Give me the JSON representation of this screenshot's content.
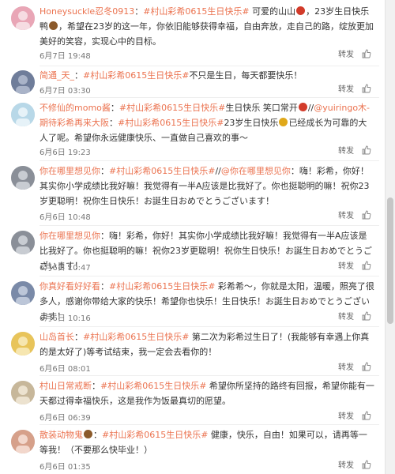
{
  "actions": {
    "repost": "转发",
    "like": "赞"
  },
  "comments": [
    {
      "name": "Honeysuckle忍冬0913",
      "sep": "：",
      "tag": "#村山彩希0615生日快乐#",
      "text1": " 可爱的山山",
      "text2": "，23岁生日快乐鸭",
      "text3": "，希望在23岁的这一年，你依旧能够获得幸福，自由奔放，走自己的路，绽放更加美好的笑容，实现心中的目标。",
      "time": "6月7日 19:48",
      "avatar_color": "#e9a6b6"
    },
    {
      "name": "简通_天_",
      "sep": "：",
      "tag": "#村山彩希0615生日快乐#",
      "text1": "不只是生日，每天都要快乐！",
      "time": "6月7日 03:30",
      "avatar_color": "#6f7d9a"
    },
    {
      "name": "不修仙的momo酱",
      "sep": "：",
      "tag": "#村山彩希0615生日快乐#",
      "text1": "生日快乐 笑口常开",
      "text2": "//",
      "mention": "@yuiringo木-期待彩希再来大阪",
      "text3": "：",
      "tag2": "#村山彩希0615生日快乐#",
      "text4": "23岁生日快乐",
      "text5": "已经成长为可靠的大人了呢。希望你永远健康快乐、一直做自己喜欢的事～",
      "time": "6月6日 19:23",
      "avatar_color": "#b8d8e8"
    },
    {
      "name": "你在哪里想见你",
      "sep": "：",
      "tag": "#村山彩希0615生日快乐#",
      "text1": "//",
      "mention": "@你在哪里想见你",
      "text2": "：嗨！彩希，你好！其实你小学成绩比我好嘛！我觉得有一半A应该是比我好了。你也挺聪明的嘛！祝你23岁更聪明！祝你生日快乐！お誕生日おめでとうございます！",
      "time": "6月6日 10:48",
      "avatar_color": "#8a8f98"
    },
    {
      "name": "你在哪里想见你",
      "sep": "：",
      "text1": "嗨！彩希，你好！其实你小学成绩比我好嘛！我觉得有一半A应该是比我好了。你也挺聪明的嘛！祝你23岁更聪明！祝你生日快乐！お誕生日おめでとうございます！",
      "time": "6月6日 10:47",
      "avatar_color": "#8a8f98"
    },
    {
      "name": "你真好看好好看",
      "sep": "：",
      "tag": "#村山彩希0615生日快乐#",
      "text1": " 彩希希～，你就是太阳，温暖，照亮了很多人，感谢你带给大家的快乐！希望你也快乐！生日快乐！お誕生日おめでとうございます！",
      "time": "6月6日 10:16",
      "avatar_color": "#7a8aa8"
    },
    {
      "name": "山岛首长",
      "sep": "：",
      "tag": "#村山彩希0615生日快乐#",
      "text1": " 第二次为彩希过生日了！(我能够有幸遇上你真的是太好了)等考试结束，我一定会去看你的！",
      "time": "6月6日 08:01",
      "avatar_color": "#e8c45a"
    },
    {
      "name": "村山日常戒断",
      "sep": "：",
      "tag": "#村山彩希0615生日快乐#",
      "text1": " 希望你所坚持的路终有回报，希望你能有一天都过得幸福快乐，这是我作为饭最真切的愿望。",
      "time": "6月6日 06:39",
      "avatar_color": "#c7b79a"
    },
    {
      "name": "散装动物鬼",
      "sep": "：",
      "tag": "#村山彩希0615生日快乐#",
      "text1": " 健康，快乐，自由！如果可以，请再等一等我！（不要那么快毕业！）",
      "time": "6月6日 01:35",
      "avatar_color": "#d6a08a"
    }
  ]
}
